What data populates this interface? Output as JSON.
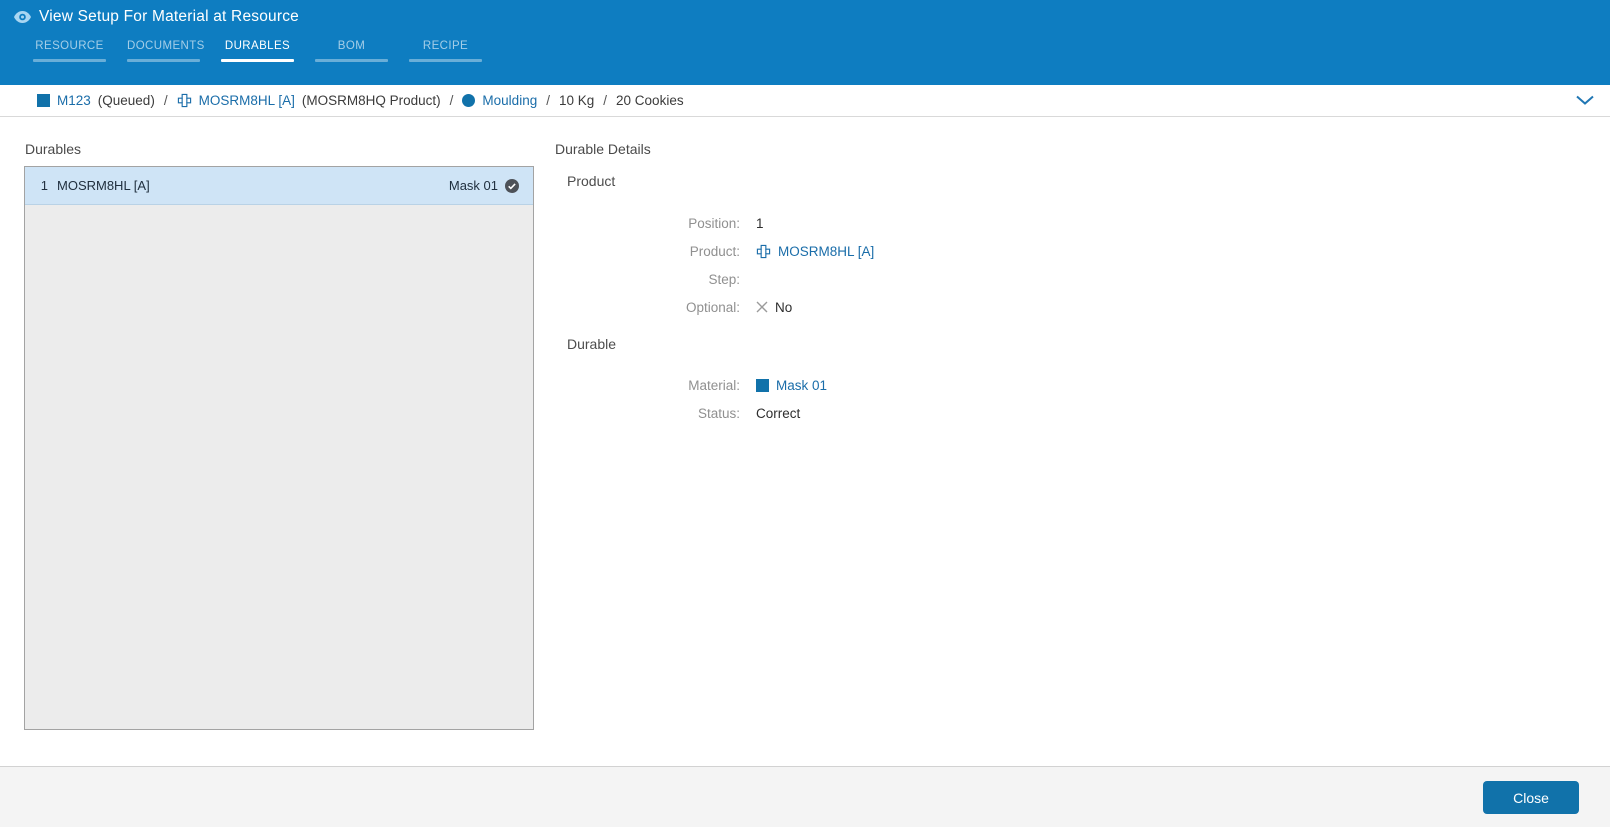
{
  "colors": {
    "header_blue": "#0e7dc1",
    "link_blue": "#1a6da9",
    "button_blue": "#1172aa",
    "selected_row_blue": "#cfe4f6"
  },
  "header": {
    "title": "View Setup For Material at Resource",
    "tabs": [
      {
        "label": "RESOURCE",
        "active": false
      },
      {
        "label": "DOCUMENTS",
        "active": false
      },
      {
        "label": "DURABLES",
        "active": true
      },
      {
        "label": "BOM",
        "active": false
      },
      {
        "label": "RECIPE",
        "active": false
      }
    ]
  },
  "breadcrumb": {
    "material_name": "M123",
    "material_state": "(Queued)",
    "sep": "/",
    "product_name": "MOSRM8HL [A]",
    "product_description": "(MOSRM8HQ Product)",
    "step_name": "Moulding",
    "primary_quantity": "10 Kg",
    "secondary_quantity": "20 Cookies"
  },
  "durables": {
    "title": "Durables",
    "items": [
      {
        "position": "1",
        "product": "MOSRM8HL [A]",
        "durable": "Mask 01"
      }
    ]
  },
  "details": {
    "title": "Durable Details",
    "product_section": {
      "title": "Product",
      "position_label": "Position:",
      "position_value": "1",
      "product_label": "Product:",
      "product_value": "MOSRM8HL [A]",
      "step_label": "Step:",
      "step_value": "",
      "optional_label": "Optional:",
      "optional_value": "No"
    },
    "durable_section": {
      "title": "Durable",
      "material_label": "Material:",
      "material_value": "Mask 01",
      "status_label": "Status:",
      "status_value": "Correct"
    }
  },
  "footer": {
    "close_label": "Close"
  }
}
